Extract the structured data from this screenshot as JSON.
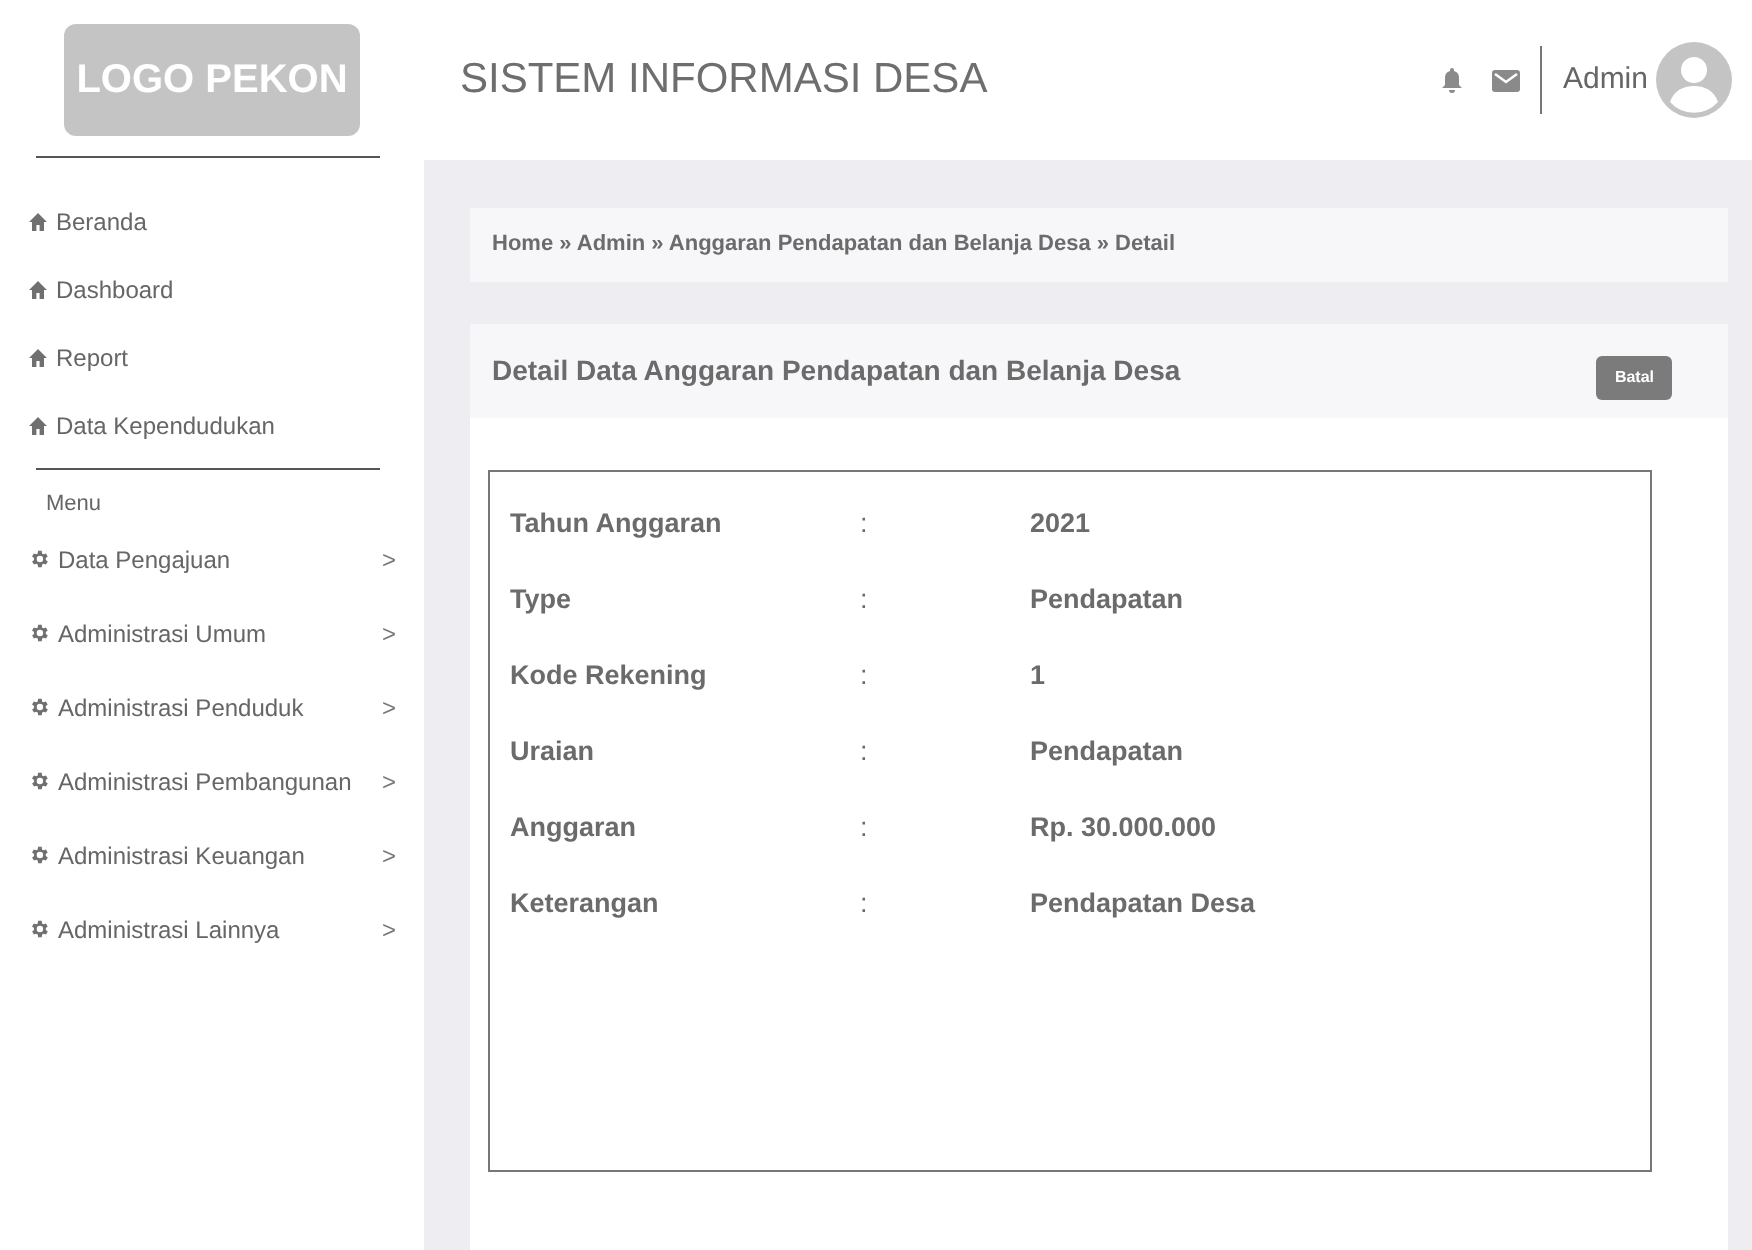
{
  "header": {
    "logo": "LOGO PEKON",
    "title": "SISTEM INFORMASI DESA",
    "user": "Admin"
  },
  "sidebar": {
    "top_items": [
      {
        "label": "Beranda"
      },
      {
        "label": "Dashboard"
      },
      {
        "label": "Report"
      },
      {
        "label": "Data Kependudukan"
      }
    ],
    "section_label": "Menu",
    "menu_items": [
      {
        "label": "Data Pengajuan",
        "chevron": ">"
      },
      {
        "label": "Administrasi Umum",
        "chevron": ">"
      },
      {
        "label": "Administrasi Penduduk",
        "chevron": ">"
      },
      {
        "label": "Administrasi Pembangunan",
        "chevron": ">"
      },
      {
        "label": "Administrasi Keuangan",
        "chevron": ">"
      },
      {
        "label": "Administrasi Lainnya",
        "chevron": ">"
      }
    ]
  },
  "breadcrumb": "Home » Admin » Anggaran Pendapatan dan Belanja Desa » Detail",
  "card": {
    "title": "Detail Data Anggaran Pendapatan dan Belanja Desa",
    "button": "Batal",
    "fields": [
      {
        "label": "Tahun Anggaran",
        "separator": ":",
        "value": "2021"
      },
      {
        "label": "Type",
        "separator": ":",
        "value": "Pendapatan"
      },
      {
        "label": "Kode Rekening",
        "separator": ":",
        "value": "1"
      },
      {
        "label": "Uraian",
        "separator": ":",
        "value": "Pendapatan"
      },
      {
        "label": "Anggaran",
        "separator": ":",
        "value": "Rp. 30.000.000"
      },
      {
        "label": "Keterangan",
        "separator": ":",
        "value": "Pendapatan Desa"
      }
    ]
  }
}
